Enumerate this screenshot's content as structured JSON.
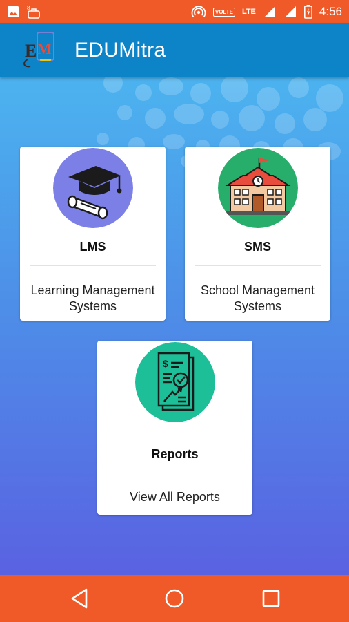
{
  "status_bar": {
    "time": "4:56",
    "volte": "VOLTE",
    "network": "LTE",
    "icons": [
      "image-icon",
      "notification-icon",
      "hotspot-icon",
      "signal-icon",
      "signal-icon",
      "battery-charging-icon"
    ]
  },
  "app": {
    "title": "EDUMitra",
    "logo_text": "EM",
    "accent_color": "#0d83c8",
    "status_color": "#f05a28"
  },
  "cards": [
    {
      "id": "lms",
      "title": "LMS",
      "desc_line1": "Learning Management",
      "desc_line2": "Systems",
      "icon": "graduation-cap-icon",
      "icon_bg": "#7b7fe6"
    },
    {
      "id": "sms",
      "title": "SMS",
      "desc_line1": "School Management",
      "desc_line2": "Systems",
      "icon": "school-building-icon",
      "icon_bg": "#27ae6b"
    },
    {
      "id": "reports",
      "title": "Reports",
      "desc_line1": "View All Reports",
      "icon": "report-document-icon",
      "icon_bg": "#1dbf98"
    }
  ],
  "nav_bar": {
    "buttons": [
      "back-icon",
      "home-icon",
      "recents-icon"
    ]
  }
}
